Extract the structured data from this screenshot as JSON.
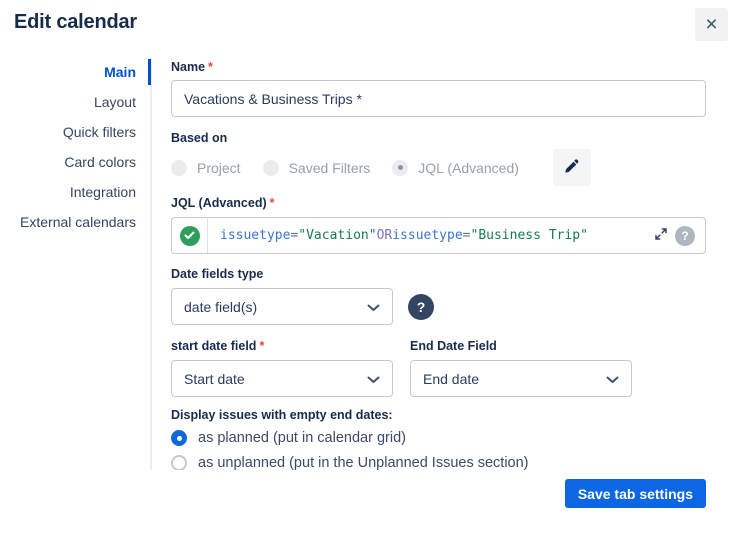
{
  "colors": {
    "accent_blue": "#0052CC",
    "primary_button_blue": "#0D66E4",
    "valid_green": "#2E9E5B",
    "required_red": "#E2483D",
    "title_navy": "#172B4D"
  },
  "required_marker": "*",
  "dialog": {
    "title": "Edit calendar",
    "close_icon": "×"
  },
  "sidebar": {
    "items": [
      {
        "label": "Main",
        "active": true
      },
      {
        "label": "Layout",
        "active": false
      },
      {
        "label": "Quick filters",
        "active": false
      },
      {
        "label": "Card colors",
        "active": false
      },
      {
        "label": "Integration",
        "active": false
      },
      {
        "label": "External calendars",
        "active": false
      }
    ]
  },
  "form": {
    "name": {
      "label": "Name",
      "required": true,
      "value": "Vacations & Business Trips *"
    },
    "based_on": {
      "label": "Based on",
      "options": [
        {
          "label": "Project",
          "selected": false,
          "disabled": true
        },
        {
          "label": "Saved Filters",
          "selected": false,
          "disabled": true
        },
        {
          "label": "JQL (Advanced)",
          "selected": true,
          "disabled": true
        }
      ],
      "edit_icon": "pencil"
    },
    "jql": {
      "label": "JQL (Advanced)",
      "required": true,
      "value": "issuetype = \"Vacation\" OR issuetype = \"Business Trip\"",
      "parts": {
        "field1": "issuetype",
        "op1": "=",
        "str1": "\"Vacation\"",
        "keyword": "OR",
        "field2": "issuetype",
        "op2": "=",
        "str2": "\"Business Trip\""
      },
      "status_icon": "check",
      "expand_icon": "diagonal-arrows",
      "help_icon": "?"
    },
    "date_fields_type": {
      "label": "Date fields type",
      "value": "date field(s)",
      "help_icon": "?"
    },
    "start_date_field": {
      "label": "start date field",
      "required": true,
      "value": "Start date"
    },
    "end_date_field": {
      "label": "End Date Field",
      "value": "End date"
    },
    "empty_end_dates": {
      "label": "Display issues with empty end dates:",
      "options": [
        {
          "label": "as planned (put in calendar grid)",
          "selected": true
        },
        {
          "label": "as unplanned (put in the Unplanned Issues section)",
          "selected": false
        }
      ]
    }
  },
  "footer": {
    "save_label": "Save tab settings"
  }
}
